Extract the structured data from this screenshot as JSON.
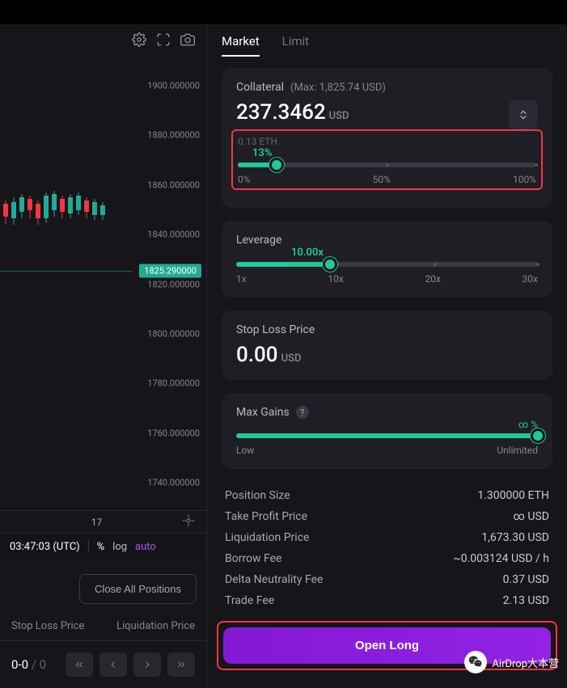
{
  "chart": {
    "yTicks": [
      "1900.000000",
      "1880.000000",
      "1860.000000",
      "1840.000000",
      "1820.000000",
      "1800.000000",
      "1780.000000",
      "1760.000000",
      "1740.000000"
    ],
    "priceTag": "1825.290000",
    "xLabel": "17",
    "time": "03:47:03 (UTC)",
    "pct": "%",
    "log": "log",
    "auto": "auto"
  },
  "positions": {
    "closeAll": "Close All Positions",
    "stopLoss": "Stop Loss Price",
    "liqPrice": "Liquidation Price",
    "page": "0-0",
    "pageTotal": " / 0"
  },
  "tabs": {
    "market": "Market",
    "limit": "Limit"
  },
  "collateral": {
    "title": "Collateral",
    "max": "(Max: 1,825.74 USD)",
    "value": "237.3462",
    "unit": "USD",
    "sub": "0.13 ETH",
    "sliderLabel": "13%",
    "labels": [
      "0%",
      "50%",
      "100%"
    ]
  },
  "leverage": {
    "title": "Leverage",
    "value": "10.00x",
    "labels": [
      "1x",
      "10x",
      "20x",
      "30x"
    ]
  },
  "stopLoss": {
    "title": "Stop Loss Price",
    "value": "0.00",
    "unit": "USD"
  },
  "maxGains": {
    "title": "Max Gains",
    "value": "∞ %",
    "labels": [
      "Low",
      "Unlimited"
    ]
  },
  "summary": [
    {
      "label": "Position Size",
      "value": "1.300000 ETH"
    },
    {
      "label": "Take Profit Price",
      "value": "∞ USD"
    },
    {
      "label": "Liquidation Price",
      "value": "1,673.30 USD"
    },
    {
      "label": "Borrow Fee",
      "value": "~0.003124 USD / h"
    },
    {
      "label": "Delta Neutrality Fee",
      "value": "0.37 USD"
    },
    {
      "label": "Trade Fee",
      "value": "2.13 USD"
    }
  ],
  "openLong": "Open Long",
  "watermark": "AirDrop大本营"
}
